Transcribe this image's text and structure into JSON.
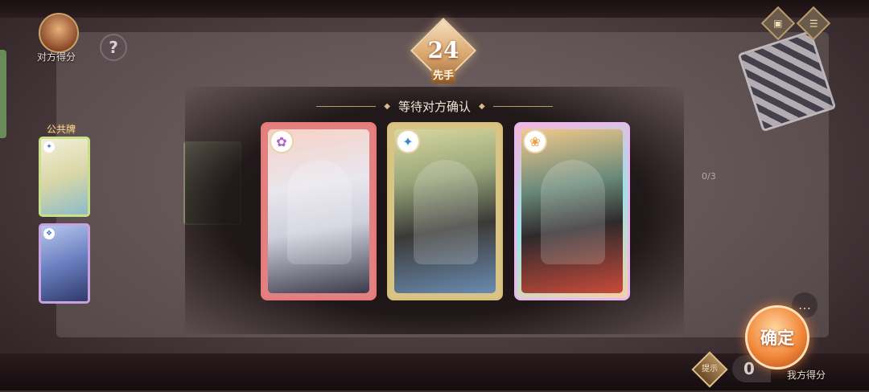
{
  "opponent": {
    "score_label": "对方得分",
    "help_label": "?"
  },
  "turn": {
    "number": "24",
    "first_label": "先手"
  },
  "status": {
    "waiting_text": "等待对方确认",
    "progress": "0/3"
  },
  "public_cards": {
    "label": "公共牌"
  },
  "cards": [
    {
      "name": "card-white-hair",
      "emblem": "✿",
      "frame_color": "#e57a7a"
    },
    {
      "name": "card-hat-scholar",
      "emblem": "✦",
      "frame_color": "#d8c07a"
    },
    {
      "name": "card-goggles",
      "emblem": "❀",
      "frame_color": "#e8b8f0"
    }
  ],
  "player": {
    "score_value": "0",
    "score_label": "我方得分",
    "hint_label": "提示"
  },
  "actions": {
    "confirm_label": "确定"
  },
  "icons": {
    "chat": "chat-icon",
    "card-deck": "deck-icon",
    "menu": "menu-icon"
  }
}
